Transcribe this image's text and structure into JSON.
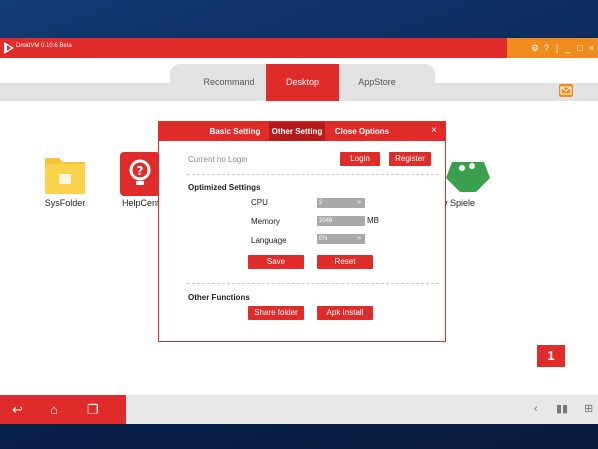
{
  "window": {
    "title": "DroidVM 0.10.6 Beta"
  },
  "tabs": [
    "Recommand",
    "Desktop",
    "AppStore"
  ],
  "active_tab": 1,
  "desktop_apps": [
    "SysFolder",
    "HelpCent",
    "ay Spiele"
  ],
  "badge_number": "1",
  "dialog": {
    "tabs": [
      "Basic Setting",
      "Other Setting",
      "Close Options"
    ],
    "active_tab": 1,
    "close": "×",
    "login_status": "Current no Login",
    "login_label": "Login",
    "register_label": "Register",
    "optimized_title": "Optimized Settings",
    "cpu_label": "CPU",
    "cpu_value": "2",
    "memory_label": "Memory",
    "memory_value": "2048",
    "memory_unit": "MB",
    "language_label": "Language",
    "language_value": "EN",
    "save_label": "Save",
    "reset_label": "Reset",
    "other_title": "Other Functions",
    "share_folder_label": "Share folder",
    "apk_install_label": "Apk Install"
  },
  "icons": {
    "logo": "droidvm-logo-icon",
    "settings": "gear-icon",
    "help": "help-icon",
    "minimize": "minimize-icon",
    "maximize": "maximize-icon",
    "close": "close-icon",
    "mail": "mail-icon",
    "back": "back-icon",
    "home": "home-icon",
    "recents": "recent-apps-icon"
  },
  "colors": {
    "accent": "#e02b2b",
    "window_controls": "#f08c1e"
  }
}
